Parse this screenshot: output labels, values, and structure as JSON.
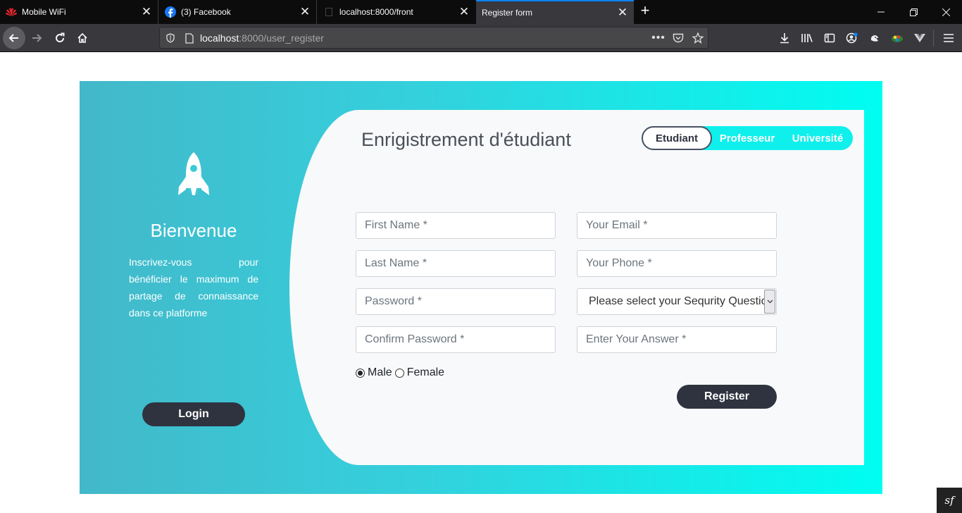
{
  "browser": {
    "tabs": [
      {
        "title": "Mobile WiFi",
        "icon": "huawei-logo-icon",
        "active": false
      },
      {
        "title": "(3) Facebook",
        "icon": "facebook-icon",
        "active": false
      },
      {
        "title": "localhost:8000/front",
        "icon": "page-icon",
        "active": false
      },
      {
        "title": "Register form",
        "icon": "page-icon",
        "active": true
      }
    ],
    "url_host": "localhost",
    "url_path": ":8000/user_register"
  },
  "page": {
    "welcome_title": "Bienvenue",
    "welcome_text": "Inscrivez-vous pour bénéficier le maximum de partage de connaissance dans ce platforme",
    "login_label": "Login",
    "form_title": "Enrigistrement d'étudiant",
    "switch": {
      "items": [
        "Etudiant",
        "Professeur",
        "Université"
      ],
      "active": "Etudiant"
    },
    "fields": {
      "first_name": "First Name *",
      "last_name": "Last Name *",
      "password": "Password *",
      "confirm_password": "Confirm Password *",
      "email": "Your Email *",
      "phone": "Your Phone *",
      "security_question": "Please select your Sequrity Question",
      "answer": "Enter Your Answer *"
    },
    "gender": {
      "male": "Male",
      "female": "Female",
      "selected": "Male"
    },
    "register_label": "Register"
  },
  "colors": {
    "gradient_start": "#43b8c9",
    "gradient_end": "#00fdf1",
    "button_dark": "#2f3340",
    "card_bg": "#f8f9fb"
  }
}
